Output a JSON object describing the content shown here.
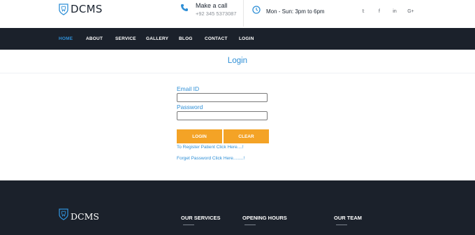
{
  "header": {
    "brand": "DCMS",
    "call_title": "Make a call",
    "call_number": "+92 345 5373087",
    "hours": "Mon - Sun: 3pm to 6pm",
    "social": [
      "twitter-icon",
      "facebook-icon",
      "linkedin-icon",
      "google-plus-icon"
    ],
    "social_glyphs": [
      "𝕥",
      "f",
      "in",
      "G+"
    ]
  },
  "nav": {
    "items": [
      "HOME",
      "ABOUT",
      "SERVICE",
      "GALLERY",
      "BLOG",
      "CONTACT",
      "LOGIN"
    ],
    "active": "HOME"
  },
  "page": {
    "title": "Login"
  },
  "form": {
    "email_label": "Email ID",
    "email_value": "",
    "password_label": "Password",
    "password_value": "",
    "login_button": "LOGIN",
    "clear_button": "CLEAR",
    "register_link": "To Register Patient Click Here....!",
    "forgot_link": "Forget Password Click Here........!"
  },
  "footer": {
    "brand": "DCMS",
    "headings": [
      "OUR SERVICES",
      "OPENING HOURS",
      "OUR TEAM"
    ]
  },
  "colors": {
    "accent": "#2f8fd6",
    "button": "#f4a326",
    "dark": "#1b212b"
  }
}
